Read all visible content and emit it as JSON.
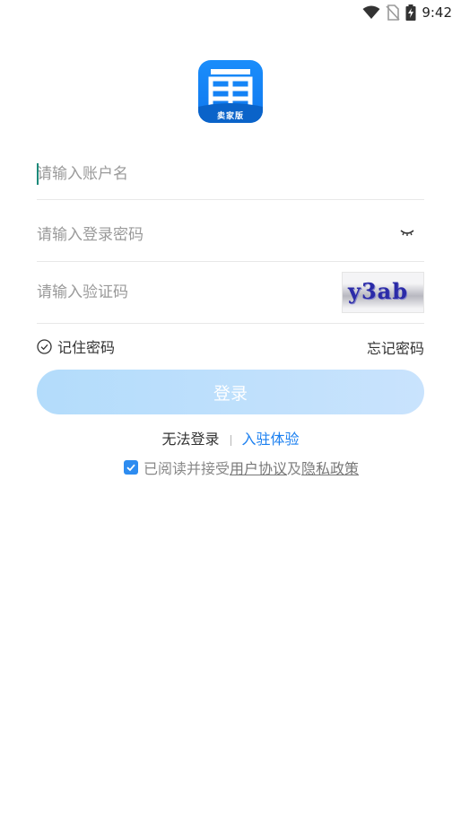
{
  "status_bar": {
    "time": "9:42",
    "icons": [
      "wifi-icon",
      "no-sim-icon",
      "battery-charging-icon"
    ]
  },
  "logo": {
    "badge_text": "卖家版",
    "icon": "ticket-grid-logo",
    "color": "#1a8dfb"
  },
  "form": {
    "account": {
      "placeholder": "请输入账户名",
      "value": ""
    },
    "password": {
      "placeholder": "请输入登录密码",
      "value": "",
      "toggle_icon": "eye-closed-icon"
    },
    "captcha": {
      "placeholder": "请输入验证码",
      "value": "",
      "image_text": "y3ab"
    }
  },
  "options": {
    "remember_label": "记住密码",
    "remember_icon": "check-circle-icon",
    "forgot_label": "忘记密码"
  },
  "login_button": {
    "label": "登录",
    "color": "#b3dcfb"
  },
  "links": {
    "cant_login": "无法登录",
    "join": "入驻体验",
    "join_color": "#1a7ff0"
  },
  "agreement": {
    "checked": true,
    "prefix": "已阅读并接受",
    "user_agreement": "用户协议",
    "conjunction": "及",
    "privacy_policy": "隐私政策"
  }
}
